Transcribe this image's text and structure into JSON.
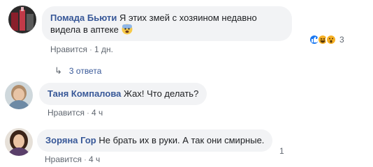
{
  "comments": [
    {
      "author": "Помада Бьюти",
      "text": "Я этих змей с хозяином недавно видела в аптеке",
      "emoji": "fearful-face-emoji",
      "like_label": "Нравится",
      "time": "1 дн.",
      "reactions": [
        "like-reaction",
        "haha-reaction",
        "wow-reaction"
      ],
      "reaction_count": "3",
      "replies_label": "3 ответа"
    },
    {
      "author": "Таня Компалова",
      "text": "Жах! Что делать?",
      "like_label": "Нравится",
      "time": "4 ч"
    },
    {
      "author": "Зоряна Гор",
      "text": "Не брать их в руки. А так они смирные.",
      "like_label": "Нравится",
      "time": "4 ч",
      "reaction_count": "1"
    }
  ],
  "separator": "·",
  "colors": {
    "link": "#385898",
    "bubble": "#f2f3f5",
    "meta": "#606770",
    "like_blue": "#1877f2",
    "haha_yellow": "#f7b125"
  }
}
